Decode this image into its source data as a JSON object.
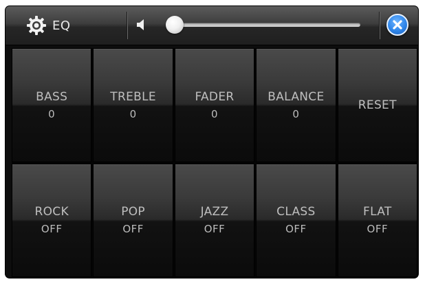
{
  "header": {
    "title": "EQ",
    "icons": {
      "settings": "gear-icon",
      "volume": "speaker-icon",
      "close": "close-icon"
    },
    "volume_level": 0.0
  },
  "controls": [
    {
      "label": "BASS",
      "value": "0"
    },
    {
      "label": "TREBLE",
      "value": "0"
    },
    {
      "label": "FADER",
      "value": "0"
    },
    {
      "label": "BALANCE",
      "value": "0"
    },
    {
      "label": "RESET"
    }
  ],
  "presets": [
    {
      "label": "ROCK",
      "value": "OFF"
    },
    {
      "label": "POP",
      "value": "OFF"
    },
    {
      "label": "JAZZ",
      "value": "OFF"
    },
    {
      "label": "CLASS",
      "value": "OFF"
    },
    {
      "label": "FLAT",
      "value": "OFF"
    }
  ],
  "colors": {
    "background": "#0d0d0d",
    "text": "#bfbfbf",
    "accent": "#2f86ea"
  }
}
